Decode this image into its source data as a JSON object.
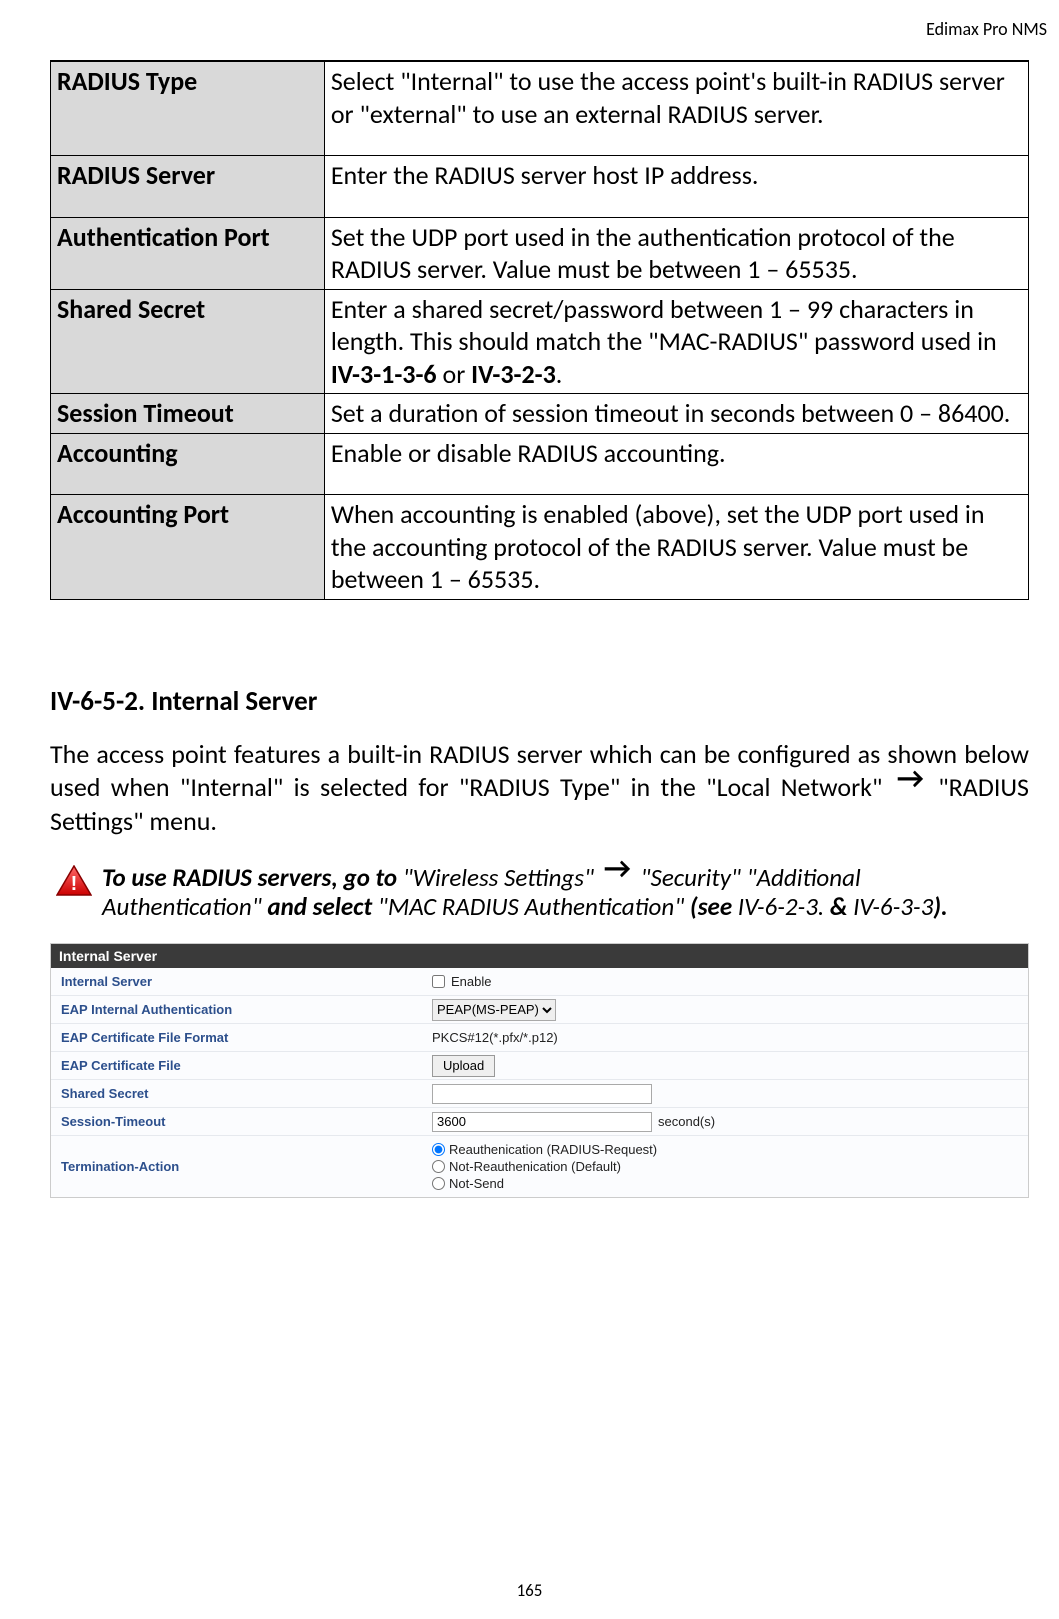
{
  "header_right": "Edimax Pro NMS",
  "table": {
    "rows": [
      {
        "label": "RADIUS Type",
        "desc_html": "Select \"Internal\" to use the access point's built-in RADIUS server or \"external\" to use an external RADIUS server.",
        "tall": true
      },
      {
        "label": "RADIUS Server",
        "desc_html": "Enter the RADIUS server host IP address.",
        "tall": true
      },
      {
        "label": "Authentication Port",
        "desc_html": "Set the UDP port used in the authentication protocol of the RADIUS server. Value must be between 1 – 65535."
      },
      {
        "label": "Shared Secret",
        "desc_html": "Enter a shared secret/password between 1 – 99 characters in length. This should match the \"MAC-RADIUS\" password used in <b>IV-3-1-3-6</b> or <b>IV-3-2-3</b>."
      },
      {
        "label": "Session Timeout",
        "desc_html": "Set a duration of session timeout in seconds between 0 – 86400."
      },
      {
        "label": "Accounting",
        "desc_html": "Enable or disable RADIUS accounting.",
        "tall": true
      },
      {
        "label": "Accounting Port",
        "desc_html": "When accounting is enabled (above), set the UDP port used in the accounting protocol of the RADIUS server. Value must be between 1 – 65535."
      }
    ]
  },
  "section": {
    "heading": "IV-6-5-2.    Internal Server",
    "para_parts": {
      "p1": "The access point features a built-in RADIUS server which can be configured as shown below used when \"Internal\" is selected for \"RADIUS Type\" in the \"Local Network\" ",
      "p2": " \"RADIUS Settings\" menu."
    },
    "warning": {
      "t1": "To use RADIUS servers, go to ",
      "t2": "\"Wireless Settings\" ",
      "t3": " \"Security\" \"Additional Authentication\" ",
      "t4": "and select ",
      "t5": "\"MAC RADIUS Authentication\" ",
      "t6": "(see ",
      "t7": "IV-6-2-3. ",
      "t8": "& ",
      "t9": "IV-6-3-3",
      "t10": ")."
    }
  },
  "panel": {
    "title": "Internal Server",
    "rows": {
      "internal_server": {
        "label": "Internal Server",
        "enable_text": "Enable"
      },
      "eap_auth": {
        "label": "EAP Internal Authentication",
        "select_value": "PEAP(MS-PEAP)"
      },
      "cert_format": {
        "label": "EAP Certificate File Format",
        "value": "PKCS#12(*.pfx/*.p12)"
      },
      "cert_file": {
        "label": "EAP Certificate File",
        "button": "Upload"
      },
      "secret": {
        "label": "Shared Secret",
        "value": ""
      },
      "timeout": {
        "label": "Session-Timeout",
        "value": "3600",
        "unit": "second(s)"
      },
      "term": {
        "label": "Termination-Action",
        "options": [
          "Reauthenication (RADIUS-Request)",
          "Not-Reauthenication (Default)",
          "Not-Send"
        ],
        "checked_index": 0
      }
    }
  },
  "page_number": "165"
}
